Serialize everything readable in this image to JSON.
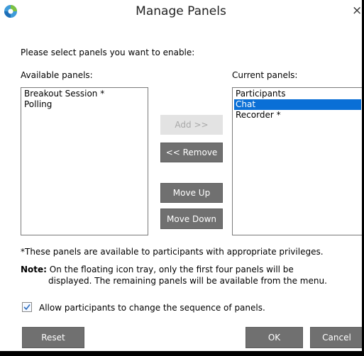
{
  "window": {
    "title": "Manage Panels",
    "close_glyph": "×",
    "app_icon": "webex-icon"
  },
  "instructions": "Please select panels you want to enable:",
  "available": {
    "label": "Available panels:",
    "items": [
      "Breakout Session *",
      "Polling"
    ]
  },
  "current": {
    "label": "Current panels:",
    "items": [
      "Participants",
      "Chat",
      "Recorder *"
    ],
    "selected_index": 1
  },
  "buttons": {
    "add": "Add >>",
    "remove": "<< Remove",
    "move_up": "Move Up",
    "move_down": "Move Down",
    "reset": "Reset",
    "ok": "OK",
    "cancel": "Cancel"
  },
  "footnote": "*These panels are available to participants with appropriate privileges.",
  "note": {
    "label": "Note:",
    "line1": "On the floating icon tray, only the first four panels will be",
    "line2": "displayed. The remaining panels will be available from the menu."
  },
  "checkbox": {
    "label": "Allow participants to change the sequence of panels.",
    "checked": true
  },
  "colors": {
    "selection": "#0a6fd6",
    "button": "#707070",
    "checkmark": "#2f6fc0"
  }
}
